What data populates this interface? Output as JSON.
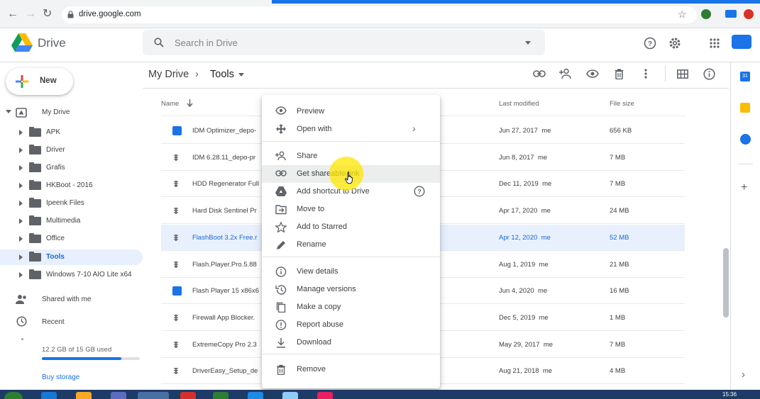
{
  "browser": {
    "url": "drive.google.com"
  },
  "header": {
    "app_name": "Drive",
    "search_placeholder": "Search in Drive"
  },
  "sidebar": {
    "new_label": "New",
    "my_drive": "My Drive",
    "folders": [
      "APK",
      "Driver",
      "Grafis",
      "HKBoot - 2016",
      "Ipeenk Files",
      "Multimedia",
      "Office",
      "Tools",
      "Windows 7-10 AIO Lite x64"
    ],
    "selected_folder": "Tools",
    "shared_with_me": "Shared with me",
    "recent": "Recent",
    "storage_text": "12.2 GB of 15 GB used",
    "storage_used_fraction": 0.81,
    "buy_storage": "Buy storage"
  },
  "breadcrumb": {
    "root": "My Drive",
    "current": "Tools"
  },
  "columns": {
    "name": "Name",
    "last_modified": "Last modified",
    "file_size": "File size"
  },
  "files": [
    {
      "name": "IDM Optimizer_depo-",
      "modified": "Jun 27, 2017",
      "owner": "me",
      "size": "656 KB",
      "icon": "app-icon"
    },
    {
      "name": "IDM 6.28.11_depo-pr",
      "modified": "Jun 8, 2017",
      "owner": "me",
      "size": "7 MB",
      "icon": "archive-icon"
    },
    {
      "name": "HDD Regenerator Full",
      "modified": "Dec 11, 2019",
      "owner": "me",
      "size": "7 MB",
      "icon": "archive-icon"
    },
    {
      "name": "Hard Disk Sentinel Pr",
      "modified": "Apr 17, 2020",
      "owner": "me",
      "size": "24 MB",
      "icon": "archive-icon"
    },
    {
      "name": "FlashBoot 3.2x Free.r",
      "modified": "Apr 12, 2020",
      "owner": "me",
      "size": "52 MB",
      "icon": "archive-icon",
      "selected": true
    },
    {
      "name": "Flash.Player.Pro.5.88",
      "modified": "Aug 1, 2019",
      "owner": "me",
      "size": "21 MB",
      "icon": "archive-icon"
    },
    {
      "name": "Flash Player 15 x86x6",
      "modified": "Jun 4, 2020",
      "owner": "me",
      "size": "16 MB",
      "icon": "app-icon"
    },
    {
      "name": "Firewall App Blocker.",
      "modified": "Dec 5, 2019",
      "owner": "me",
      "size": "1 MB",
      "icon": "archive-icon"
    },
    {
      "name": "ExtremeCopy Pro 2.3",
      "modified": "May 29, 2017",
      "owner": "me",
      "size": "7 MB",
      "icon": "archive-icon"
    },
    {
      "name": "DriverEasy_Setup_de",
      "modified": "Aug 21, 2018",
      "owner": "me",
      "size": "4 MB",
      "icon": "archive-icon"
    }
  ],
  "context_menu": {
    "items": [
      {
        "label": "Preview",
        "icon": "eye-icon"
      },
      {
        "label": "Open with",
        "icon": "move-arrows-icon"
      },
      {
        "label": "Share",
        "icon": "person-add-icon"
      },
      {
        "label": "Get shareable link",
        "icon": "link-icon"
      },
      {
        "label": "Add shortcut to Drive",
        "icon": "shortcut-icon"
      },
      {
        "label": "Move to",
        "icon": "move-to-icon"
      },
      {
        "label": "Add to Starred",
        "icon": "star-icon"
      },
      {
        "label": "Rename",
        "icon": "pencil-icon"
      },
      {
        "label": "View details",
        "icon": "info-icon"
      },
      {
        "label": "Manage versions",
        "icon": "history-icon"
      },
      {
        "label": "Make a copy",
        "icon": "copy-icon"
      },
      {
        "label": "Report abuse",
        "icon": "report-icon"
      },
      {
        "label": "Download",
        "icon": "download-icon"
      },
      {
        "label": "Remove",
        "icon": "trash-icon"
      }
    ],
    "hovered": "Get shareable link"
  },
  "taskbar": {
    "clock": "15:36"
  },
  "colors": {
    "accent": "#1a73e8",
    "selected_bg": "#e8f0fe",
    "selected_text": "#1967d2",
    "highlight": "#ffe600"
  }
}
